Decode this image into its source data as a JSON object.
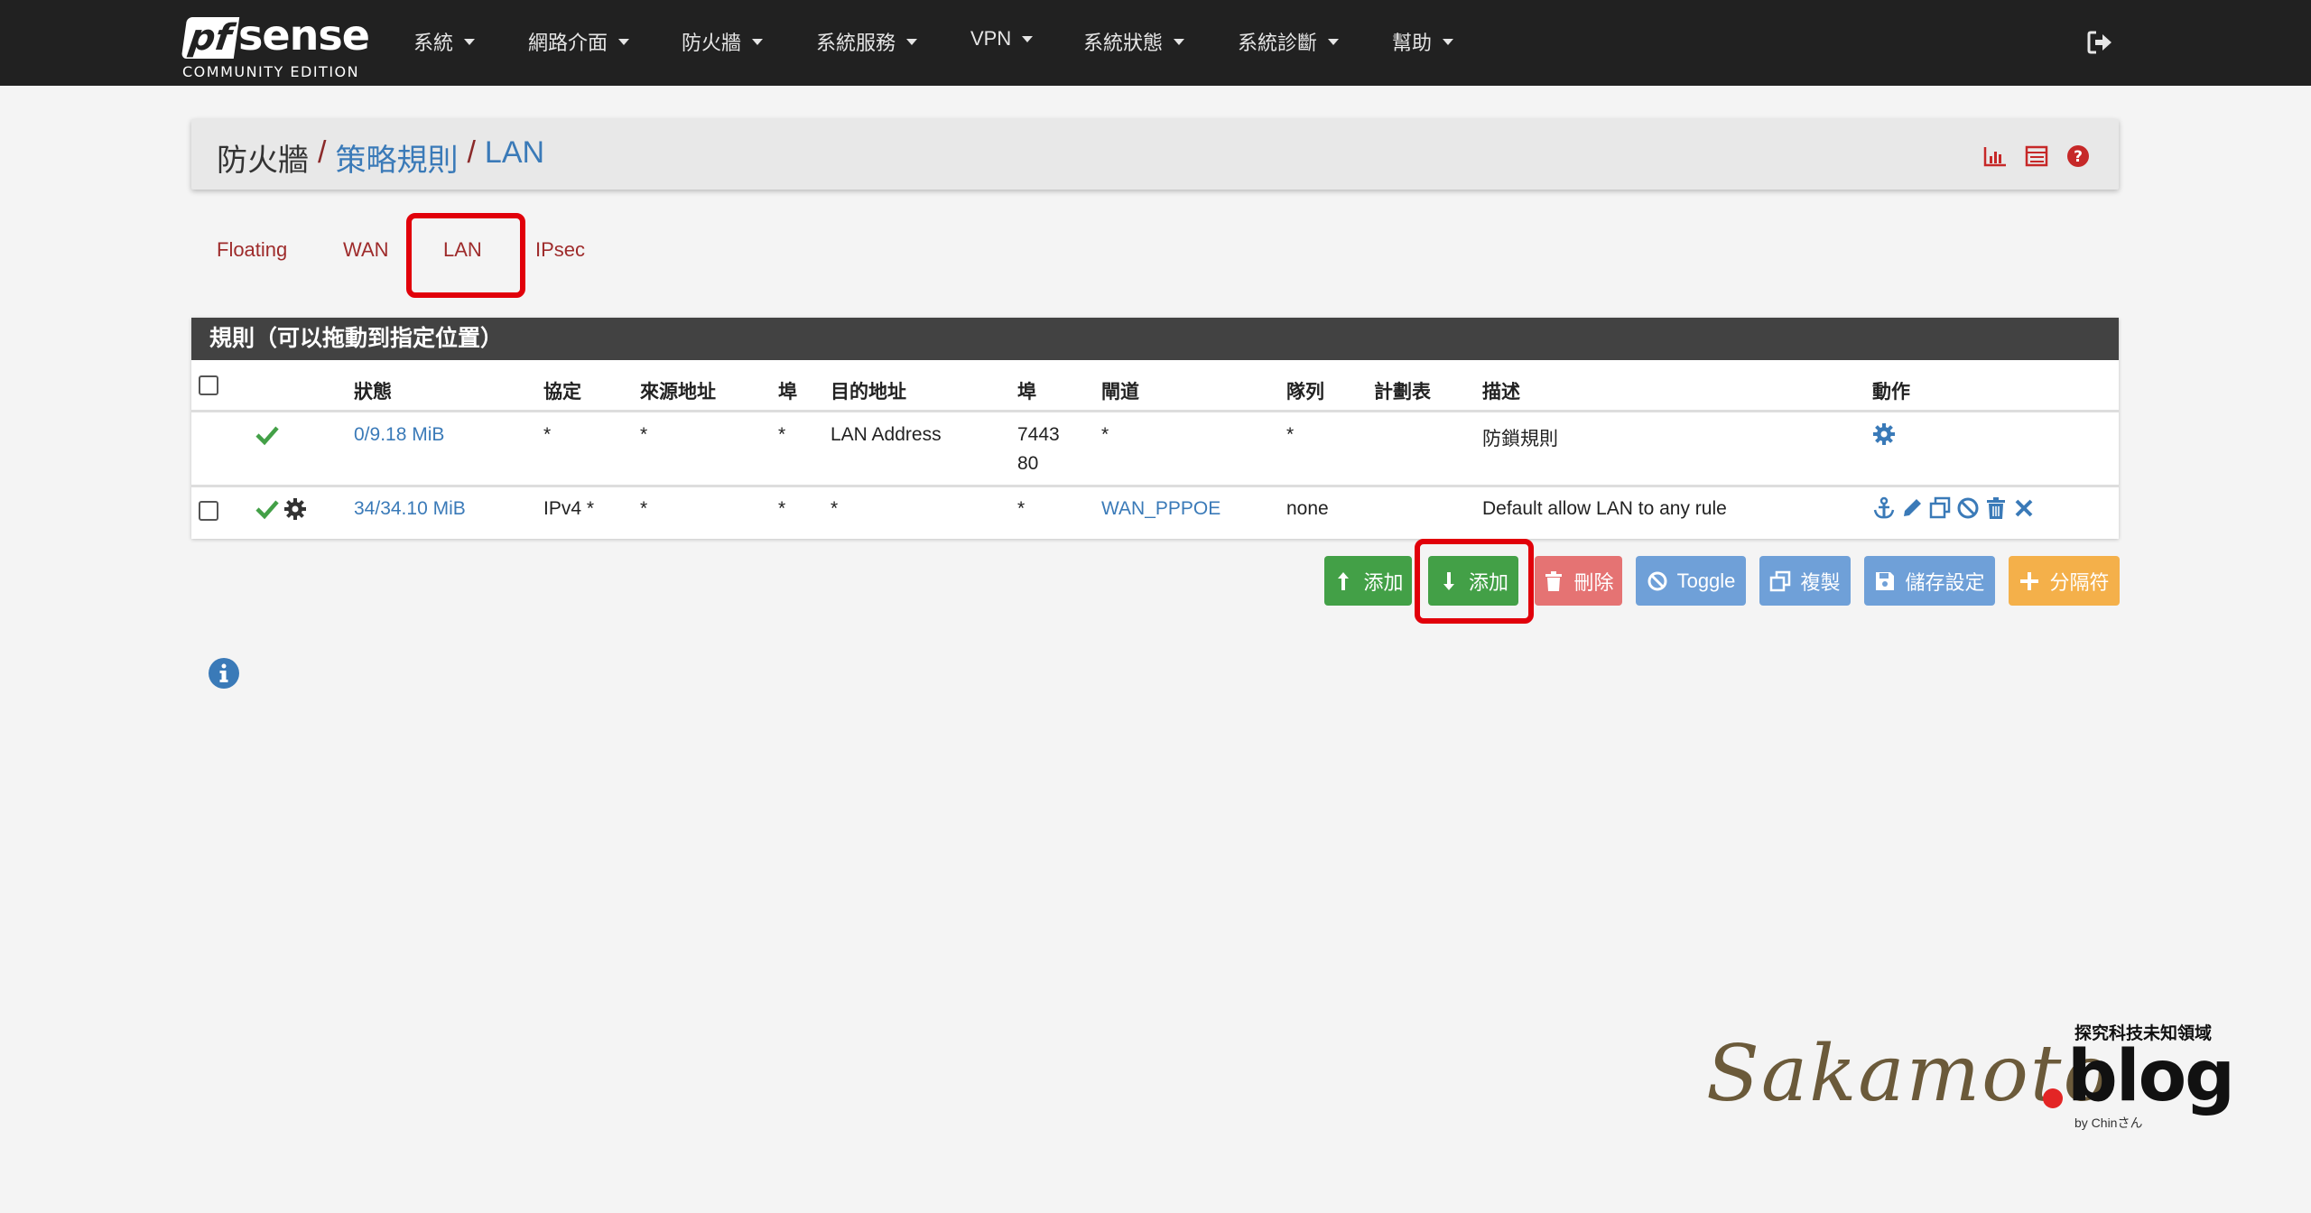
{
  "brand": {
    "logo_pf": "pf",
    "logo_sense": "sense",
    "edition": "COMMUNITY EDITION"
  },
  "nav": {
    "items": [
      {
        "label": "系統"
      },
      {
        "label": "網路介面"
      },
      {
        "label": "防火牆"
      },
      {
        "label": "系統服務"
      },
      {
        "label": "VPN"
      },
      {
        "label": "系統狀態"
      },
      {
        "label": "系統診斷"
      },
      {
        "label": "幫助"
      }
    ]
  },
  "breadcrumb": {
    "part1": "防火牆",
    "sep": "/",
    "part2": "策略規則",
    "part3": "LAN"
  },
  "tabs": [
    {
      "label": "Floating"
    },
    {
      "label": "WAN"
    },
    {
      "label": "LAN"
    },
    {
      "label": "IPsec"
    }
  ],
  "rules_table": {
    "heading": "規則（可以拖動到指定位置）",
    "headers": {
      "status": "狀態",
      "protocol": "協定",
      "source": "來源地址",
      "src_port": "埠",
      "destination": "目的地址",
      "dst_port": "埠",
      "gateway": "閘道",
      "queue": "隊列",
      "schedule": "計劃表",
      "description": "描述",
      "actions": "動作"
    },
    "rows": [
      {
        "states": "0/9.18 MiB",
        "protocol": "*",
        "source": "*",
        "src_port": "*",
        "destination": "LAN Address",
        "dst_port_line1": "7443",
        "dst_port_line2": "80",
        "gateway": "*",
        "queue": "*",
        "schedule": "",
        "description": "防鎖規則"
      },
      {
        "states": "34/34.10 MiB",
        "protocol": "IPv4 *",
        "source": "*",
        "src_port": "*",
        "destination": "*",
        "dst_port": "*",
        "gateway": "WAN_PPPOE",
        "queue": "none",
        "schedule": "",
        "description": "Default allow LAN to any rule"
      }
    ]
  },
  "buttons": {
    "add_top": "添加",
    "add_bottom": "添加",
    "delete": "刪除",
    "toggle": "Toggle",
    "copy": "複製",
    "save": "儲存設定",
    "separator": "分隔符"
  },
  "watermark": {
    "script": "Sakamoto",
    "blog": "blog",
    "tagline": "探究科技未知領域",
    "by": "by Chinさん"
  },
  "colors": {
    "navbar": "#212121",
    "link": "#3a7ab8",
    "tab": "#9e2b2b",
    "success": "#43a047",
    "danger": "#e57373",
    "info": "#6fa0d8",
    "warning": "#f4b04a",
    "highlight": "#e1000a"
  }
}
